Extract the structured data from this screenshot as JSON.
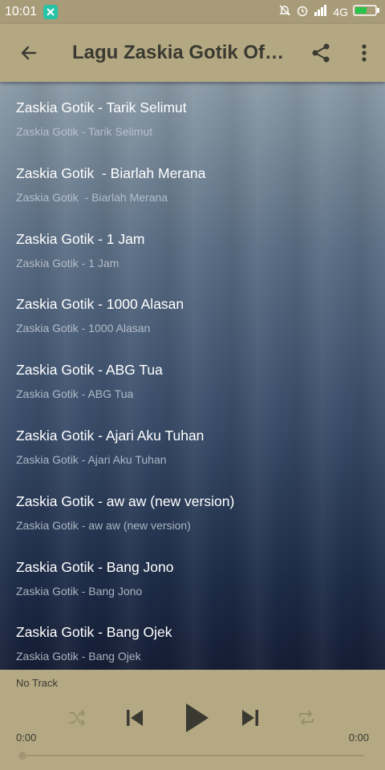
{
  "statusbar": {
    "time": "10:01",
    "network": "4G"
  },
  "toolbar": {
    "title": "Lagu Zaskia Gotik Offline Terlengkap",
    "back_icon": "arrow-back-icon",
    "share_icon": "share-icon",
    "more_icon": "more-vert-icon"
  },
  "tracks": [
    {
      "title": "Zaskia Gotik - Tarik Selimut",
      "subtitle": "Zaskia Gotik - Tarik Selimut"
    },
    {
      "title": "Zaskia Gotik  - Biarlah Merana",
      "subtitle": "Zaskia Gotik  - Biarlah Merana"
    },
    {
      "title": "Zaskia Gotik - 1 Jam",
      "subtitle": "Zaskia Gotik - 1 Jam"
    },
    {
      "title": "Zaskia Gotik - 1000 Alasan",
      "subtitle": "Zaskia Gotik - 1000 Alasan"
    },
    {
      "title": "Zaskia Gotik - ABG Tua",
      "subtitle": "Zaskia Gotik - ABG Tua"
    },
    {
      "title": "Zaskia Gotik - Ajari Aku Tuhan",
      "subtitle": "Zaskia Gotik - Ajari Aku Tuhan"
    },
    {
      "title": "Zaskia Gotik - aw aw (new version)",
      "subtitle": "Zaskia Gotik - aw aw (new version)"
    },
    {
      "title": "Zaskia Gotik - Bang Jono",
      "subtitle": "Zaskia Gotik - Bang Jono"
    },
    {
      "title": "Zaskia Gotik - Bang Ojek",
      "subtitle": "Zaskia Gotik - Bang Ojek"
    }
  ],
  "player": {
    "now_playing": "No Track",
    "elapsed": "0:00",
    "duration": "0:00",
    "progress": 0
  },
  "colors": {
    "statusbar_bg": "#a89c78",
    "toolbar_bg": "#b4a882",
    "player_bg": "#b5a983",
    "icon_dark": "#3a3a32"
  }
}
